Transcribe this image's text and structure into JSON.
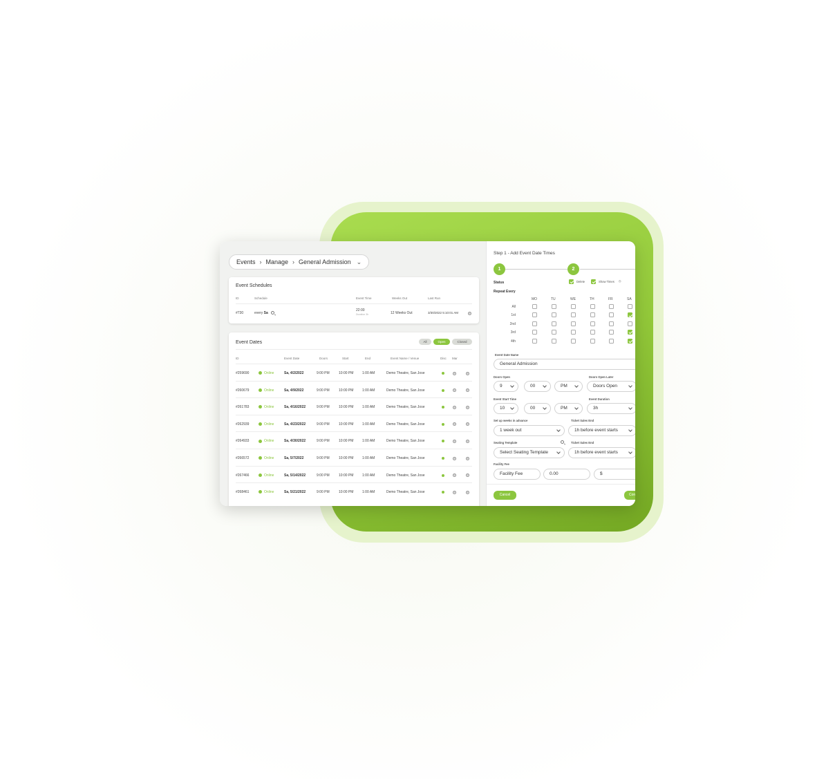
{
  "breadcrumb": {
    "items": [
      "Events",
      "Manage",
      "General Admission"
    ]
  },
  "schedules": {
    "title": "Event Schedules",
    "headers": [
      "ID",
      "Schedule",
      "Event Time",
      "Weeks Out",
      "Last Run"
    ],
    "row": {
      "id": "#730",
      "schedule_prefix": "every",
      "schedule_day": "Sa",
      "event_time": "22:00",
      "duration": "Duration 3h",
      "weeks_out": "12 Weeks Out",
      "last_run": "3/30/2022 5:10:01 AM"
    }
  },
  "dates": {
    "title": "Event Dates",
    "filters": [
      "All",
      "Open",
      "Closed"
    ],
    "active_filter": "Open",
    "headers": [
      "ID",
      "Event Date",
      "Doors",
      "Start",
      "End",
      "Event Name / Venue",
      "Disc",
      "Mar"
    ],
    "rows": [
      {
        "id": "#259690",
        "status": "Online",
        "date": "Sa, 4/2/2022",
        "doors": "9:00 PM",
        "start": "10:00 PM",
        "end": "1:00 AM",
        "venue": "Demo Theatre, San Jose"
      },
      {
        "id": "#260679",
        "status": "Online",
        "date": "Sa, 4/9/2022",
        "doors": "9:00 PM",
        "start": "10:00 PM",
        "end": "1:00 AM",
        "venue": "Demo Theatre, San Jose"
      },
      {
        "id": "#261783",
        "status": "Online",
        "date": "Sa, 4/16/2022",
        "doors": "9:00 PM",
        "start": "10:00 PM",
        "end": "1:00 AM",
        "venue": "Demo Theatre, San Jose"
      },
      {
        "id": "#262939",
        "status": "Online",
        "date": "Sa, 4/23/2022",
        "doors": "9:00 PM",
        "start": "10:00 PM",
        "end": "1:00 AM",
        "venue": "Demo Theatre, San Jose"
      },
      {
        "id": "#264933",
        "status": "Online",
        "date": "Sa, 4/30/2022",
        "doors": "9:00 PM",
        "start": "10:00 PM",
        "end": "1:00 AM",
        "venue": "Demo Theatre, San Jose"
      },
      {
        "id": "#266572",
        "status": "Online",
        "date": "Sa, 5/7/2022",
        "doors": "9:00 PM",
        "start": "10:00 PM",
        "end": "1:00 AM",
        "venue": "Demo Theatre, San Jose"
      },
      {
        "id": "#267466",
        "status": "Online",
        "date": "Sa, 5/14/2022",
        "doors": "9:00 PM",
        "start": "10:00 PM",
        "end": "1:00 AM",
        "venue": "Demo Theatre, San Jose"
      },
      {
        "id": "#268461",
        "status": "Online",
        "date": "Sa, 5/21/2022",
        "doors": "9:00 PM",
        "start": "10:00 PM",
        "end": "1:00 AM",
        "venue": "Demo Theatre, San Jose"
      }
    ]
  },
  "wizard": {
    "step_title": "Step 1 - Add Event Date Times",
    "steps": [
      "1",
      "2"
    ],
    "status_label": "Status",
    "delete_label": "Delete",
    "show_times_label": "Show Times",
    "repeat_label": "Repeat Every",
    "days": [
      "MO",
      "TU",
      "WE",
      "TH",
      "FR",
      "SA"
    ],
    "weeks": [
      "All",
      "1st",
      "2nd",
      "3rd",
      "4th"
    ],
    "checked": [
      [
        false,
        false,
        false,
        false,
        false,
        false
      ],
      [
        false,
        false,
        false,
        false,
        false,
        true
      ],
      [
        false,
        false,
        false,
        false,
        false,
        false
      ],
      [
        false,
        false,
        false,
        false,
        false,
        true
      ],
      [
        false,
        false,
        false,
        false,
        false,
        true
      ]
    ],
    "event_date_name_label": "Event Date Name",
    "event_date_name": "General Admission",
    "doors_open_label": "Doors Open",
    "doors_hour": "9",
    "doors_min": "00",
    "doors_ampm": "PM",
    "doors_open_later_label": "Doors Open Later",
    "doors_open_later": "Doors Open",
    "start_time_label": "Event Start Time",
    "start_hour": "10",
    "start_min": "00",
    "start_ampm": "PM",
    "duration_label": "Event Duration",
    "duration": "3h",
    "weeks_advance_label": "Set up weeks in advance",
    "weeks_advance": "1 week out",
    "ticket_sales_end_label": "Ticket Sales End",
    "ticket_sales_end": "1h before event starts",
    "seating_template_label": "Seating Template",
    "seating_template": "Select Seating Template",
    "ticket_sales_end2_label": "Ticket Sales End",
    "ticket_sales_end2": "1h before event starts",
    "facility_fee_label": "Facility Fee",
    "facility_fee_name": "Facility Fee",
    "facility_fee_amount": "0.00",
    "facility_fee_currency": "$",
    "cancel_label": "Cancel",
    "continue_label": "Con"
  }
}
